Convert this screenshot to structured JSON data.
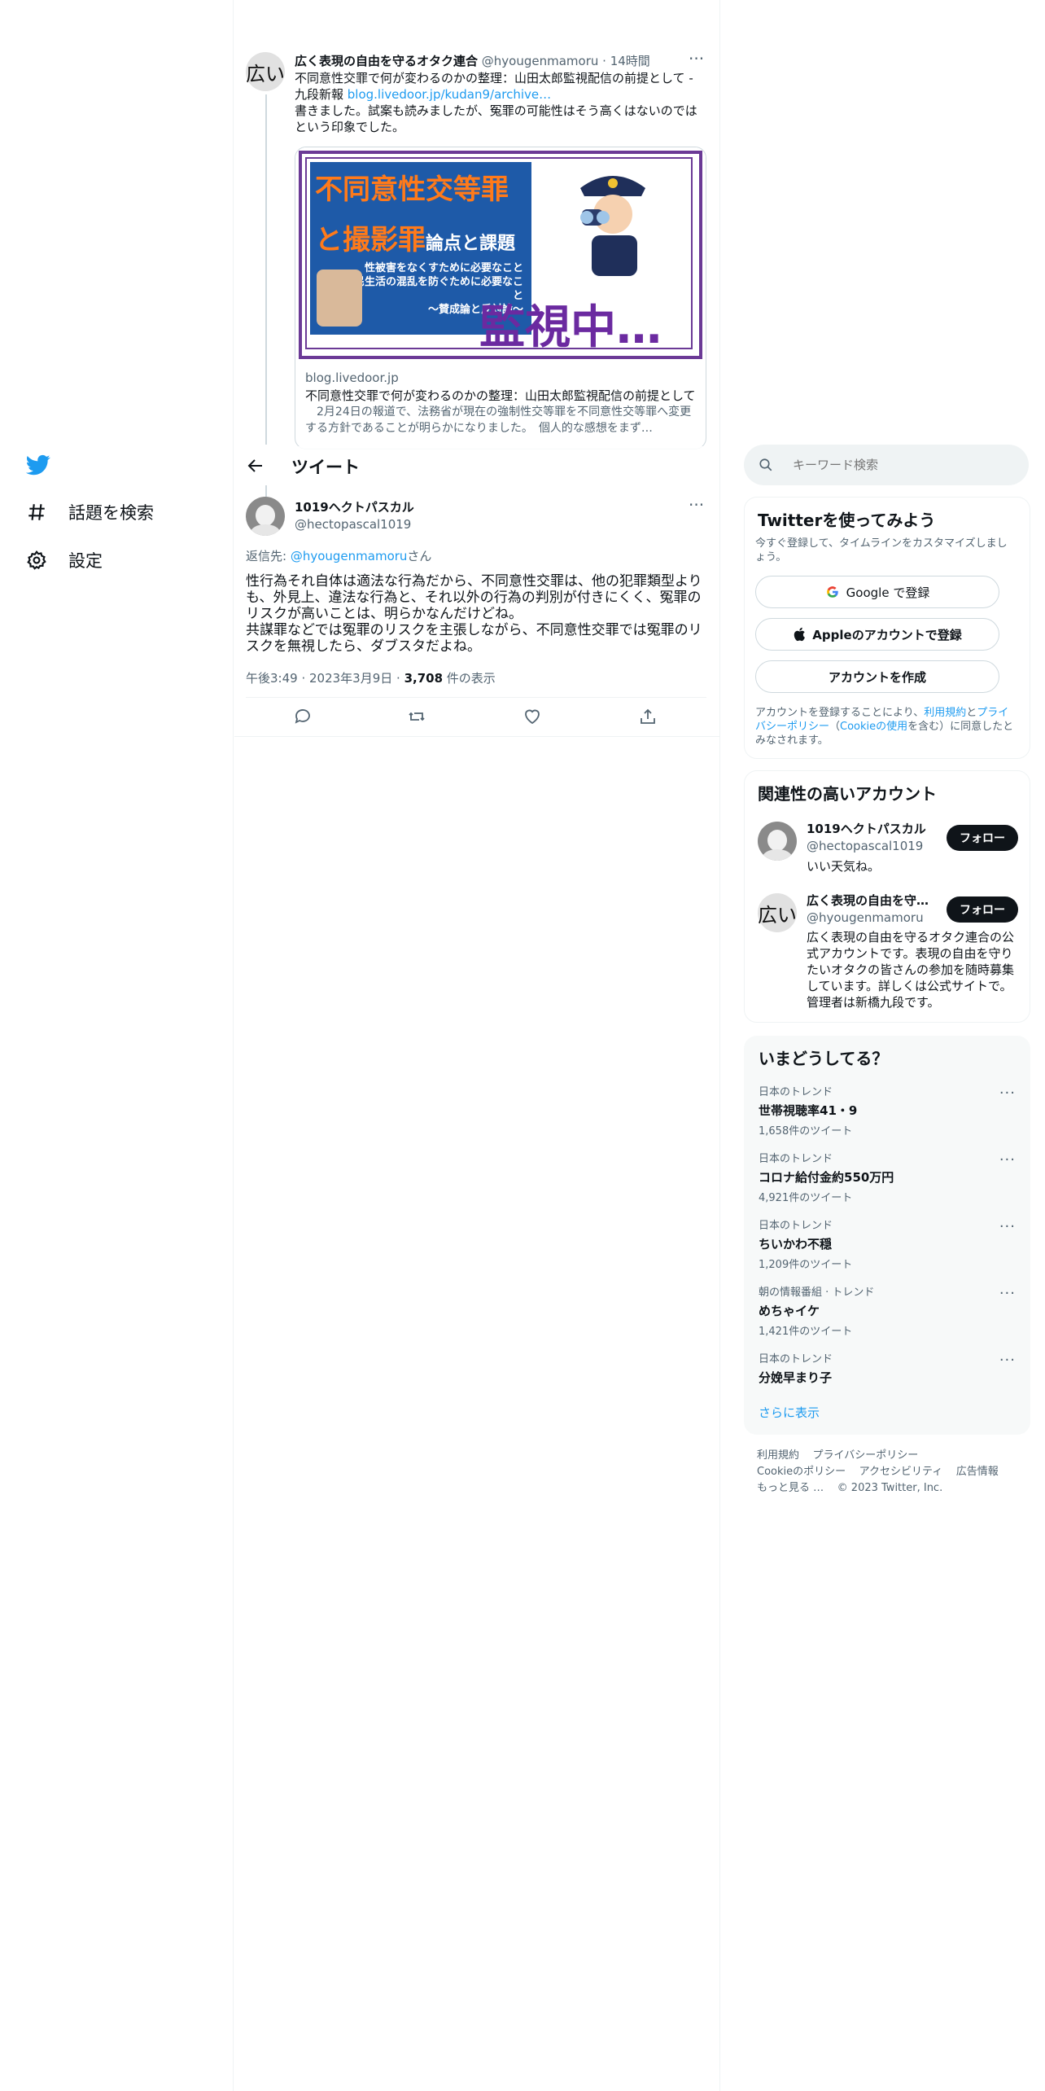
{
  "nav": {
    "items": [
      {
        "label": "話題を検索",
        "icon": "hashtag-icon"
      },
      {
        "label": "設定",
        "icon": "gear-icon"
      }
    ]
  },
  "parent_tweet": {
    "avatar_text": "広い",
    "name": "広く表現の自由を守るオタク連合",
    "handle": "@hyougenmamoru",
    "time": "· 14時間",
    "text1": "不同意性交罪で何が変わるのかの整理：山田太郎監視配信の前提として - 九段新報 ",
    "link": "blog.livedoor.jp/kudan9/archive…",
    "text2": "書きました。試案も読みましたが、冤罪の可能性はそう高くはないのではという印象でした。",
    "card": {
      "img_title_line1": "不同意性交等罪",
      "img_title_line2": "と撮影罪",
      "img_title_suffix": "論点と課題",
      "img_sub1": "性被害をなくすために必要なこと",
      "img_sub2": "国民生活の混乱を防ぐために必要なこと",
      "img_sub3": "〜賛成論と反対論〜",
      "img_big": "監視中…",
      "domain": "blog.livedoor.jp",
      "title": "不同意性交罪で何が変わるのかの整理：山田太郎監視配信の前提として",
      "description": "2月24日の報道で、法務省が現在の強制性交等罪を不同意性交等罪へ変更する方針であることが明らかになりました。　個人的な感想をまず…"
    }
  },
  "header": {
    "title": "ツイート"
  },
  "main_tweet": {
    "name": "1019ヘクトパスカル",
    "handle": "@hectopascal1019",
    "reply_prefix": "返信先: ",
    "reply_to": "@hyougenmamoru",
    "reply_suffix": "さん",
    "text_line1": "性行為それ自体は適法な行為だから、不同意性交罪は、他の犯罪類型よりも、外見上、違法な行為と、それ以外の行為の判別が付きにくく、冤罪のリスクが高いことは、明らかなんだけどね。",
    "text_line2": "共謀罪などでは冤罪のリスクを主張しながら、不同意性交罪では冤罪のリスクを無視したら、ダブスタだよね。",
    "time": "午後3:49 · 2023年3月9日 · ",
    "views": "3,708",
    "views_label": " 件の表示"
  },
  "search": {
    "placeholder": "キーワード検索"
  },
  "signup": {
    "title": "Twitterを使ってみよう",
    "subtitle": "今すぐ登録して、タイムラインをカスタマイズしましょう。",
    "google": "Google で登録",
    "apple": "Appleのアカウントで登録",
    "create": "アカウントを作成",
    "terms_pre": "アカウントを登録することにより、",
    "terms_link1": "利用規約",
    "terms_and": "と",
    "terms_link2": "プライバシーポリシー",
    "terms_paren_open": "（",
    "terms_link3": "Cookieの使用",
    "terms_post": "を含む）に同意したとみなされます。"
  },
  "relevant": {
    "title": "関連性の高いアカウント",
    "follow_label": "フォロー",
    "accounts": [
      {
        "name": "1019ヘクトパスカル",
        "handle": "@hectopascal1019",
        "bio": "いい天気ね。"
      },
      {
        "avatar_text": "広い",
        "name": "広く表現の自由を守…",
        "handle": "@hyougenmamoru",
        "bio": "広く表現の自由を守るオタク連合の公式アカウントです。表現の自由を守りたいオタクの皆さんの参加を随時募集しています。詳しくは公式サイトで。管理者は新橋九段です。"
      }
    ]
  },
  "trends": {
    "title": "いまどうしてる？",
    "items": [
      {
        "category": "日本のトレンド",
        "title": "世帯視聴率41・9",
        "count": "1,658件のツイート"
      },
      {
        "category": "日本のトレンド",
        "title": "コロナ給付金約550万円",
        "count": "4,921件のツイート"
      },
      {
        "category": "日本のトレンド",
        "title": "ちいかわ不穏",
        "count": "1,209件のツイート"
      },
      {
        "category": "朝の情報番組 · トレンド",
        "title": "めちゃイケ",
        "count": "1,421件のツイート"
      },
      {
        "category": "日本のトレンド",
        "title": "分娩早まり子",
        "count": ""
      }
    ],
    "show_more": "さらに表示"
  },
  "footer": {
    "line1": [
      "利用規約",
      "プライバシーポリシー"
    ],
    "line2": [
      "Cookieのポリシー",
      "アクセシビリティ",
      "広告情報"
    ],
    "more": "もっと見る …",
    "copyright": "© 2023 Twitter, Inc."
  },
  "colors": {
    "brand": "#1d9bf0",
    "text": "#0f1419",
    "muted": "#536471"
  }
}
